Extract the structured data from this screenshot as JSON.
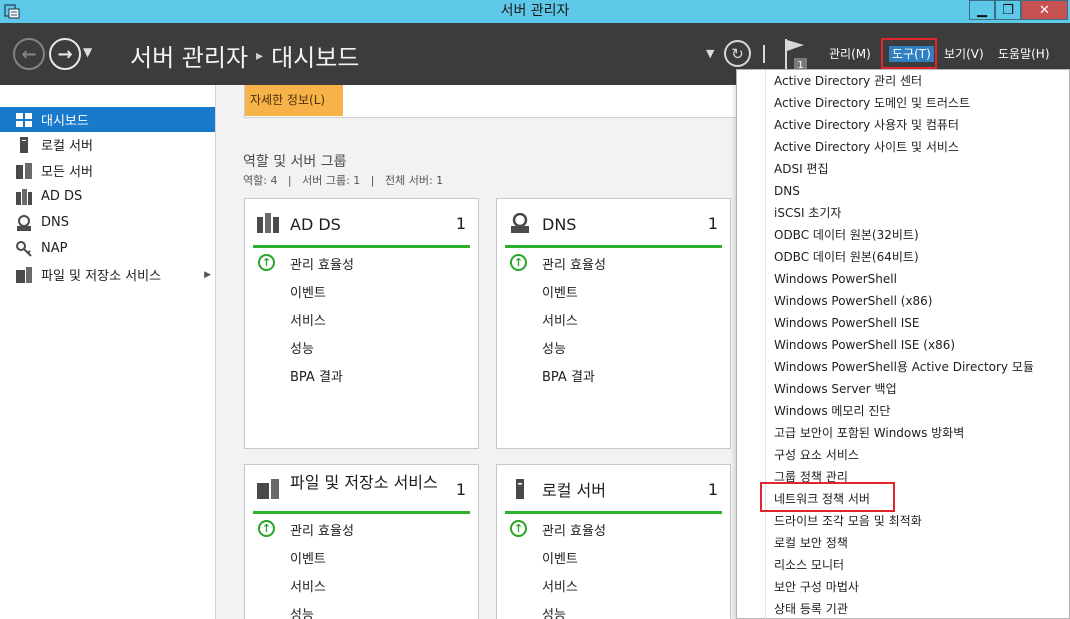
{
  "window": {
    "title": "서버 관리자",
    "min_glyph": "▁",
    "max_glyph": "❐",
    "close_glyph": "✕"
  },
  "header": {
    "breadcrumb": [
      "서버 관리자",
      "대시보드"
    ],
    "breadcrumb_sep": "▸",
    "menu": [
      "관리(M)",
      "도구(T)",
      "보기(V)",
      "도움말(H)"
    ],
    "notification_count": "1"
  },
  "sidebar": {
    "items": [
      {
        "label": "대시보드",
        "icon": "dashboard-icon",
        "active": true
      },
      {
        "label": "로컬 서버",
        "icon": "server-icon"
      },
      {
        "label": "모든 서버",
        "icon": "servers-icon"
      },
      {
        "label": "AD DS",
        "icon": "adds-icon"
      },
      {
        "label": "DNS",
        "icon": "dns-icon"
      },
      {
        "label": "NAP",
        "icon": "nap-icon"
      },
      {
        "label": "파일 및 저장소 서비스",
        "icon": "storage-icon",
        "has_arrow": true
      }
    ]
  },
  "main": {
    "detail_tab": "자세한 정보(L)",
    "groups_title": "역할 및 서버 그룹",
    "groups_stats": "역할: 4   |   서버 그룹: 1   |   전체 서버: 1",
    "tiles": [
      {
        "name": "AD DS",
        "count": "1",
        "icon": "adds-icon",
        "rows": [
          "관리 효율성",
          "이벤트",
          "서비스",
          "성능",
          "BPA 결과"
        ]
      },
      {
        "name": "DNS",
        "count": "1",
        "icon": "dns-icon",
        "rows": [
          "관리 효율성",
          "이벤트",
          "서비스",
          "성능",
          "BPA 결과"
        ]
      },
      {
        "name": "파일 및 저장소 서비스",
        "count": "1",
        "icon": "storage-icon",
        "rows": [
          "관리 효율성",
          "이벤트",
          "서비스",
          "성능"
        ]
      },
      {
        "name": "로컬 서버",
        "count": "1",
        "icon": "server-icon",
        "rows": [
          "관리 효율성",
          "이벤트",
          "서비스",
          "성능"
        ]
      }
    ]
  },
  "tools_menu": {
    "items": [
      "Active Directory 관리 센터",
      "Active Directory 도메인 및 트러스트",
      "Active Directory 사용자 및 컴퓨터",
      "Active Directory 사이트 및 서비스",
      "ADSI 편집",
      "DNS",
      "iSCSI 초기자",
      "ODBC 데이터 원본(32비트)",
      "ODBC 데이터 원본(64비트)",
      "Windows PowerShell",
      "Windows PowerShell (x86)",
      "Windows PowerShell ISE",
      "Windows PowerShell ISE (x86)",
      "Windows PowerShell용 Active Directory 모듈",
      "Windows Server 백업",
      "Windows 메모리 진단",
      "고급 보안이 포함된 Windows 방화벽",
      "구성 요소 서비스",
      "그룹 정책 관리",
      "네트워크 정책 서버",
      "드라이브 조각 모음 및 최적화",
      "로컬 보안 정책",
      "리소스 모니터",
      "보안 구성 마법사",
      "상태 등록 기관"
    ],
    "highlighted_index": 19
  },
  "colors": {
    "titlebar": "#5ec8e8",
    "header": "#3c3c3c",
    "sidebar_active": "#1979ca",
    "status_green": "#2db02d",
    "highlight_red": "#e0262c",
    "detail_tab": "#f7b34a"
  }
}
